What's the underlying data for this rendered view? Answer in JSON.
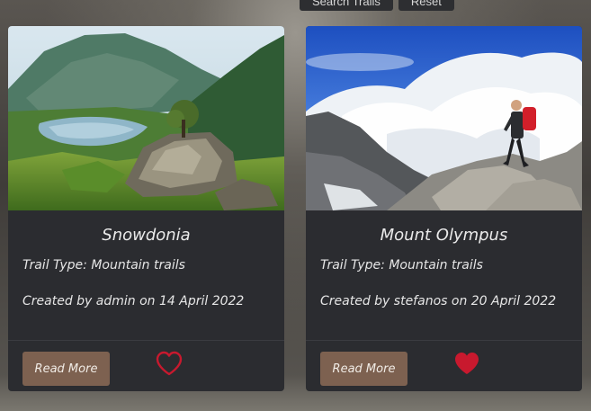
{
  "toolbar": {
    "search_label": "Search Trails",
    "reset_label": "Reset"
  },
  "colors": {
    "card_bg": "#2b2c30",
    "button_bg": "#7d6150",
    "heart": "#c8192e",
    "text": "#e6e6e6"
  },
  "cards": [
    {
      "title": "Snowdonia",
      "trail_type": "Trail Type: Mountain trails",
      "created": "Created by admin on 14 April 2022",
      "read_more_label": "Read More",
      "liked": false,
      "image_icon": "mountain-lake-photo"
    },
    {
      "title": "Mount Olympus",
      "trail_type": "Trail Type: Mountain trails",
      "created": "Created by stefanos on 20 April 2022",
      "read_more_label": "Read More",
      "liked": true,
      "image_icon": "hiker-above-clouds-photo"
    }
  ]
}
